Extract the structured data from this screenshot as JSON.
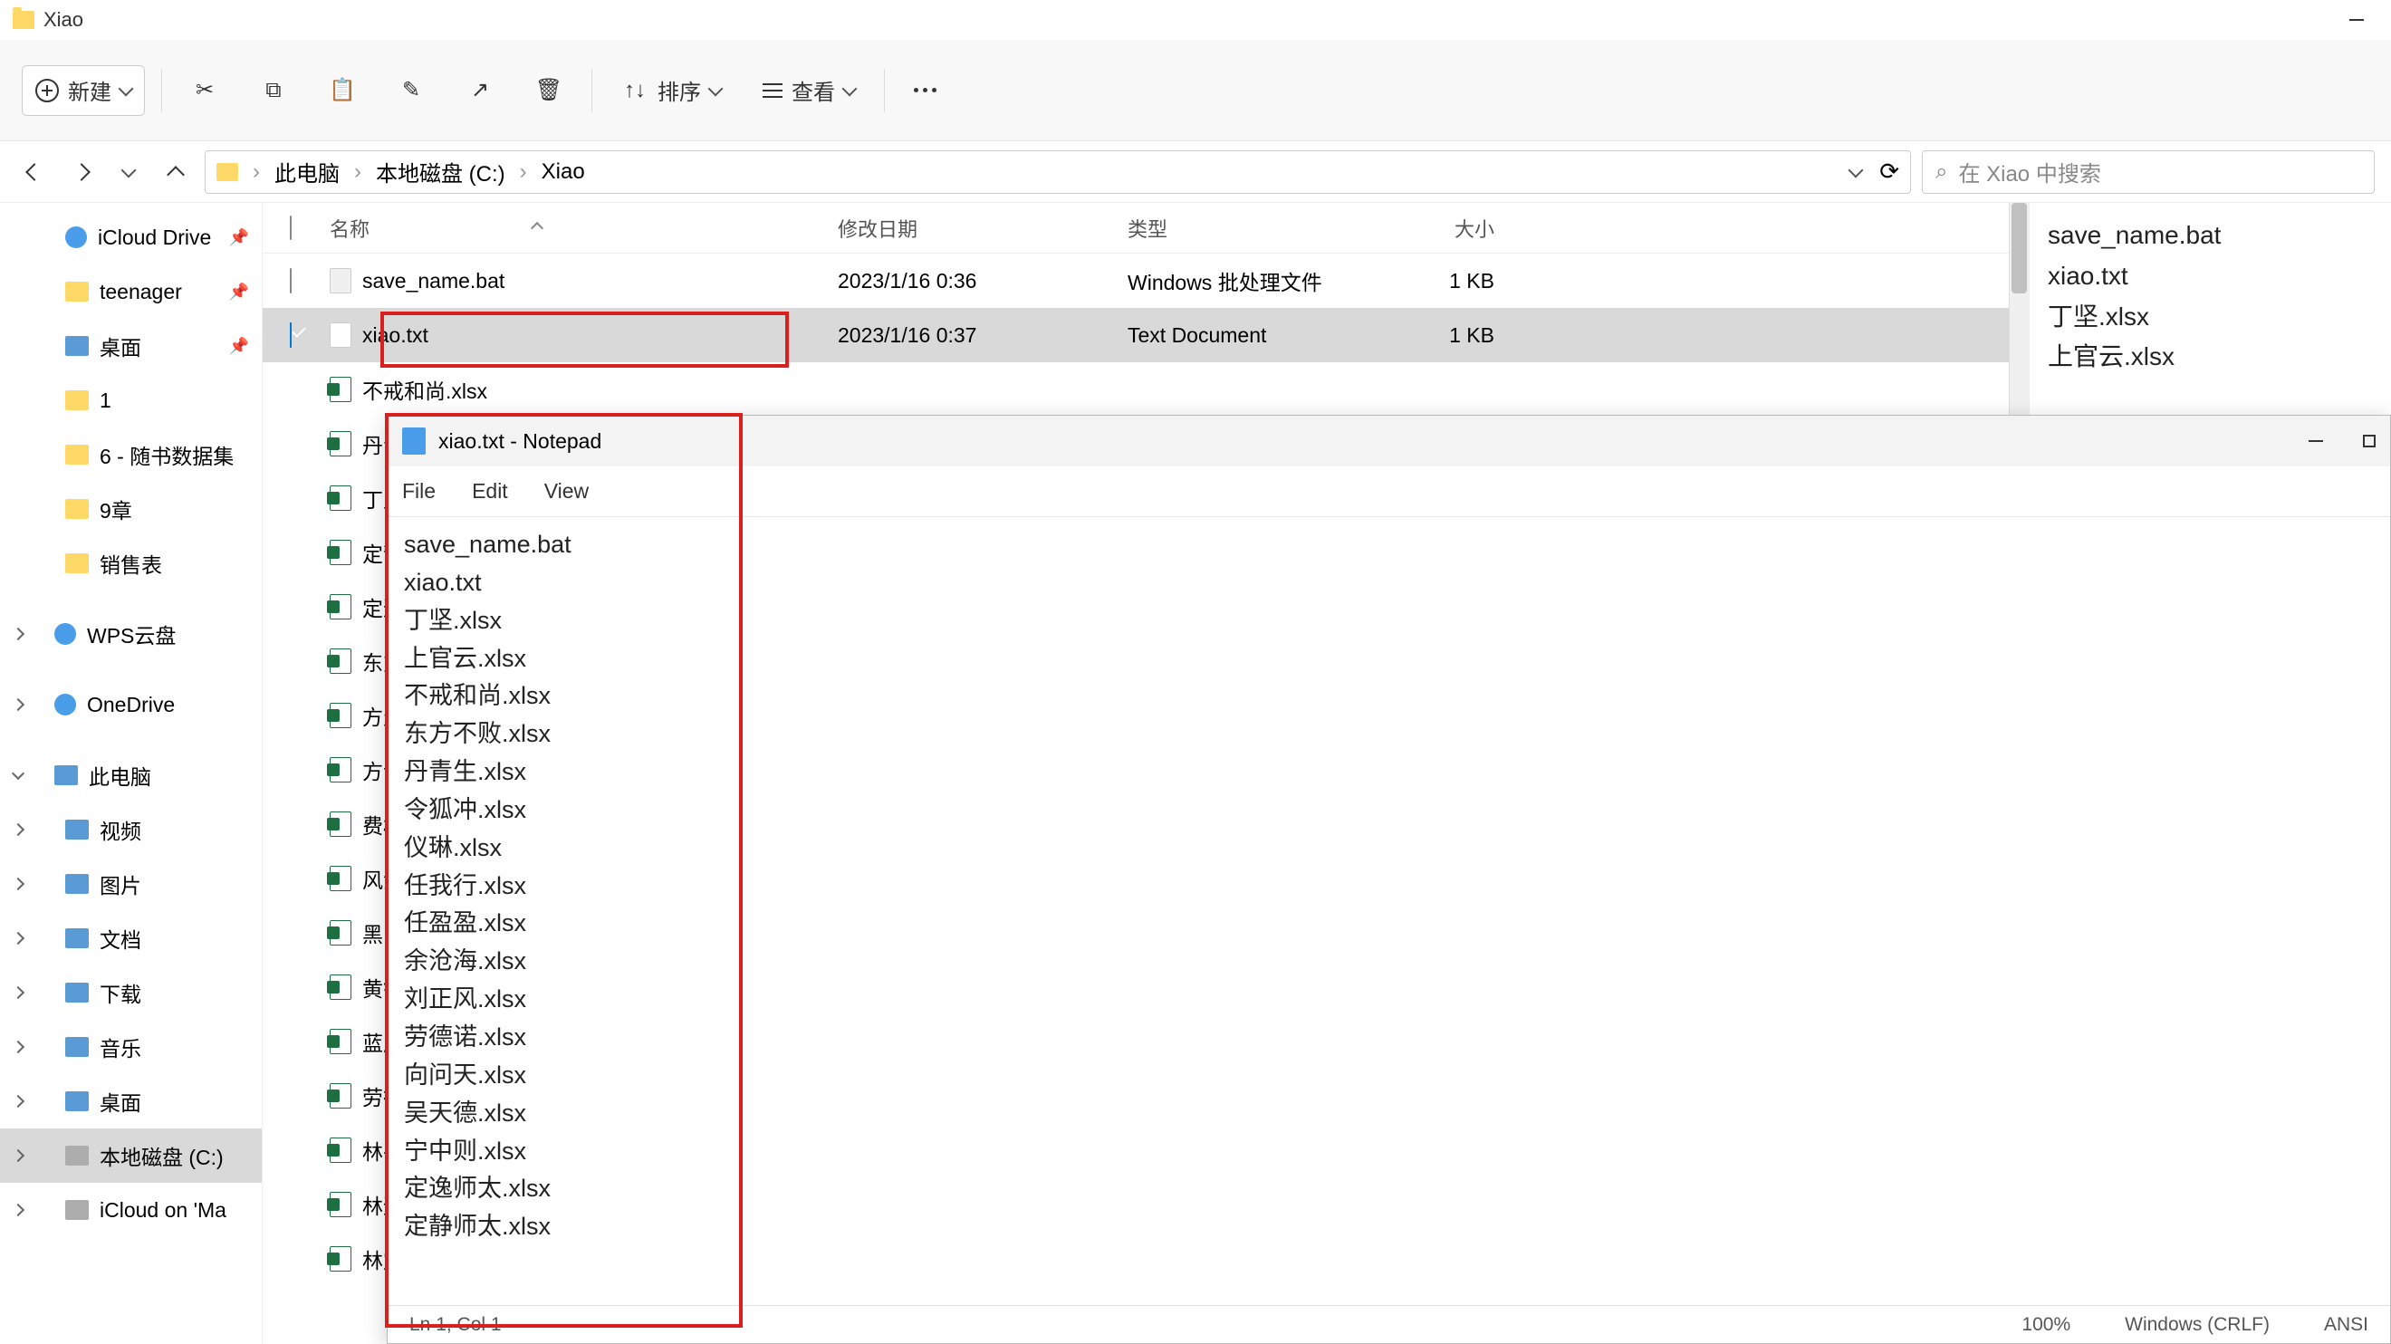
{
  "window": {
    "title": "Xiao"
  },
  "toolbar": {
    "new": "新建",
    "sort": "排序",
    "view": "查看"
  },
  "breadcrumb": {
    "p1": "此电脑",
    "p2": "本地磁盘 (C:)",
    "p3": "Xiao"
  },
  "search": {
    "placeholder": "在 Xiao 中搜索"
  },
  "sidebar": {
    "items": [
      {
        "label": "iCloud Drive",
        "pin": true,
        "ico": "ico-cloud"
      },
      {
        "label": "teenager",
        "pin": true,
        "ico": "ico-folder-y"
      },
      {
        "label": "桌面",
        "pin": true,
        "ico": "ico-pc"
      },
      {
        "label": "1",
        "ico": "ico-folder-y"
      },
      {
        "label": "6 - 随书数据集",
        "ico": "ico-folder-y"
      },
      {
        "label": "9章",
        "ico": "ico-folder-y"
      },
      {
        "label": "销售表",
        "ico": "ico-folder-y"
      }
    ],
    "wps": "WPS云盘",
    "onedrive": "OneDrive",
    "pc": "此电脑",
    "pc_children": [
      "视频",
      "图片",
      "文档",
      "下载",
      "音乐",
      "桌面",
      "本地磁盘 (C:)",
      "iCloud on 'Ma"
    ]
  },
  "columns": {
    "name": "名称",
    "date": "修改日期",
    "type": "类型",
    "size": "大小"
  },
  "files": [
    {
      "name": "save_name.bat",
      "date": "2023/1/16 0:36",
      "type": "Windows 批处理文件",
      "size": "1 KB",
      "ico": "bat",
      "selected": false
    },
    {
      "name": "xiao.txt",
      "date": "2023/1/16 0:37",
      "type": "Text Document",
      "size": "1 KB",
      "ico": "txt",
      "selected": true
    },
    {
      "name": "不戒和尚.xlsx",
      "ico": "xlsx"
    },
    {
      "name": "丹青生.xlsx",
      "ico": "xlsx"
    },
    {
      "name": "丁坚.xlsx",
      "ico": "xlsx"
    },
    {
      "name": "定静师太.xlsx",
      "ico": "xlsx"
    },
    {
      "name": "定逸师太.xlsx",
      "ico": "xlsx"
    },
    {
      "name": "东方不败.xlsx",
      "ico": "xlsx"
    },
    {
      "name": "方生.xlsx",
      "ico": "xlsx"
    },
    {
      "name": "方证.xlsx",
      "ico": "xlsx"
    },
    {
      "name": "费彬.xlsx",
      "ico": "xlsx"
    },
    {
      "name": "风清扬.xlsx",
      "ico": "xlsx"
    },
    {
      "name": "黑白子.xlsx",
      "ico": "xlsx"
    },
    {
      "name": "黄钟公.xlsx",
      "ico": "xlsx"
    },
    {
      "name": "蓝凤凰.xlsx",
      "ico": "xlsx"
    },
    {
      "name": "劳德诺.xlsx",
      "ico": "xlsx"
    },
    {
      "name": "林平之.xlsx",
      "ico": "xlsx"
    },
    {
      "name": "林远图.xlsx",
      "ico": "xlsx"
    },
    {
      "name": "林震南.xlsx",
      "ico": "xlsx"
    }
  ],
  "details": {
    "lines": [
      "save_name.bat",
      "xiao.txt",
      "丁坚.xlsx",
      "上官云.xlsx"
    ]
  },
  "notepad": {
    "title": "xiao.txt - Notepad",
    "menu": {
      "file": "File",
      "edit": "Edit",
      "view": "View"
    },
    "content": [
      "save_name.bat",
      "xiao.txt",
      "丁坚.xlsx",
      "上官云.xlsx",
      "不戒和尚.xlsx",
      "东方不败.xlsx",
      "丹青生.xlsx",
      "令狐冲.xlsx",
      "仪琳.xlsx",
      "任我行.xlsx",
      "任盈盈.xlsx",
      "余沧海.xlsx",
      "刘正风.xlsx",
      "劳德诺.xlsx",
      "向问天.xlsx",
      "吴天德.xlsx",
      "宁中则.xlsx",
      "定逸师太.xlsx",
      "定静师太.xlsx"
    ],
    "status": {
      "pos": "Ln 1, Col 1",
      "zoom": "100%",
      "eol": "Windows (CRLF)",
      "enc": "ANSI"
    }
  }
}
